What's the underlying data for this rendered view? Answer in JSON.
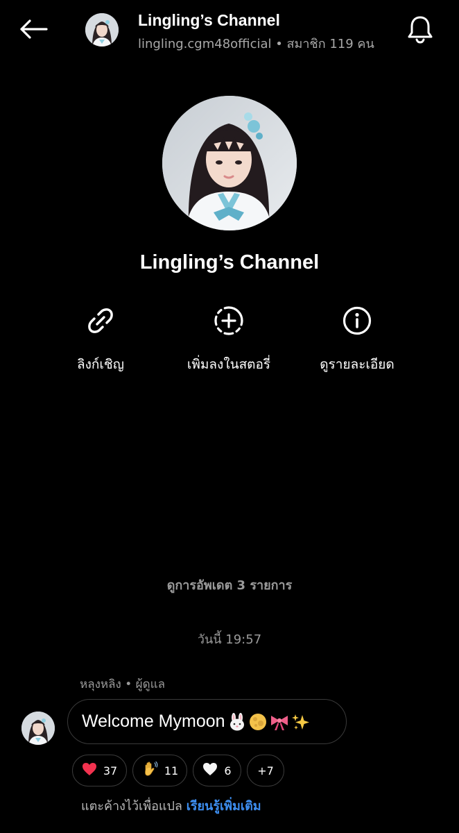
{
  "header": {
    "back_icon": "arrow-left-icon",
    "title": "Lingling’s Channel",
    "subtitle": "lingling.cgm48official • สมาชิก 119 คน",
    "bell_icon": "bell-icon"
  },
  "profile": {
    "name": "Lingling’s Channel"
  },
  "actions": [
    {
      "icon": "link-icon",
      "label": "ลิงก์เชิญ"
    },
    {
      "icon": "add-to-story-icon",
      "label": "เพิ่มลงในสตอรี่"
    },
    {
      "icon": "info-icon",
      "label": "ดูรายละเอียด"
    }
  ],
  "feed": {
    "updates_link": "ดูการอัพเดต 3 รายการ",
    "date_label": "วันนี้ 19:57",
    "sender": "หลุงหลิง • ผู้ดูแล",
    "message": {
      "text": "Welcome Mymoon",
      "emojis": [
        "rabbit-emoji",
        "full-moon-emoji",
        "ribbon-emoji",
        "sparkles-emoji"
      ]
    },
    "reactions": [
      {
        "icon": "red-heart-emoji",
        "count": "37"
      },
      {
        "icon": "waving-hand-emoji",
        "count": "11"
      },
      {
        "icon": "white-heart-emoji",
        "count": "6"
      },
      {
        "icon": "",
        "count": "+7"
      }
    ],
    "translate_hint": "แตะค้างไว้เพื่อแปล",
    "learn_more": "เรียนรู้เพิ่มเติม"
  },
  "colors": {
    "background": "#000000",
    "text_secondary": "#9a9a9a",
    "link_blue": "#3d8ef0",
    "border": "#3a3a3a"
  }
}
